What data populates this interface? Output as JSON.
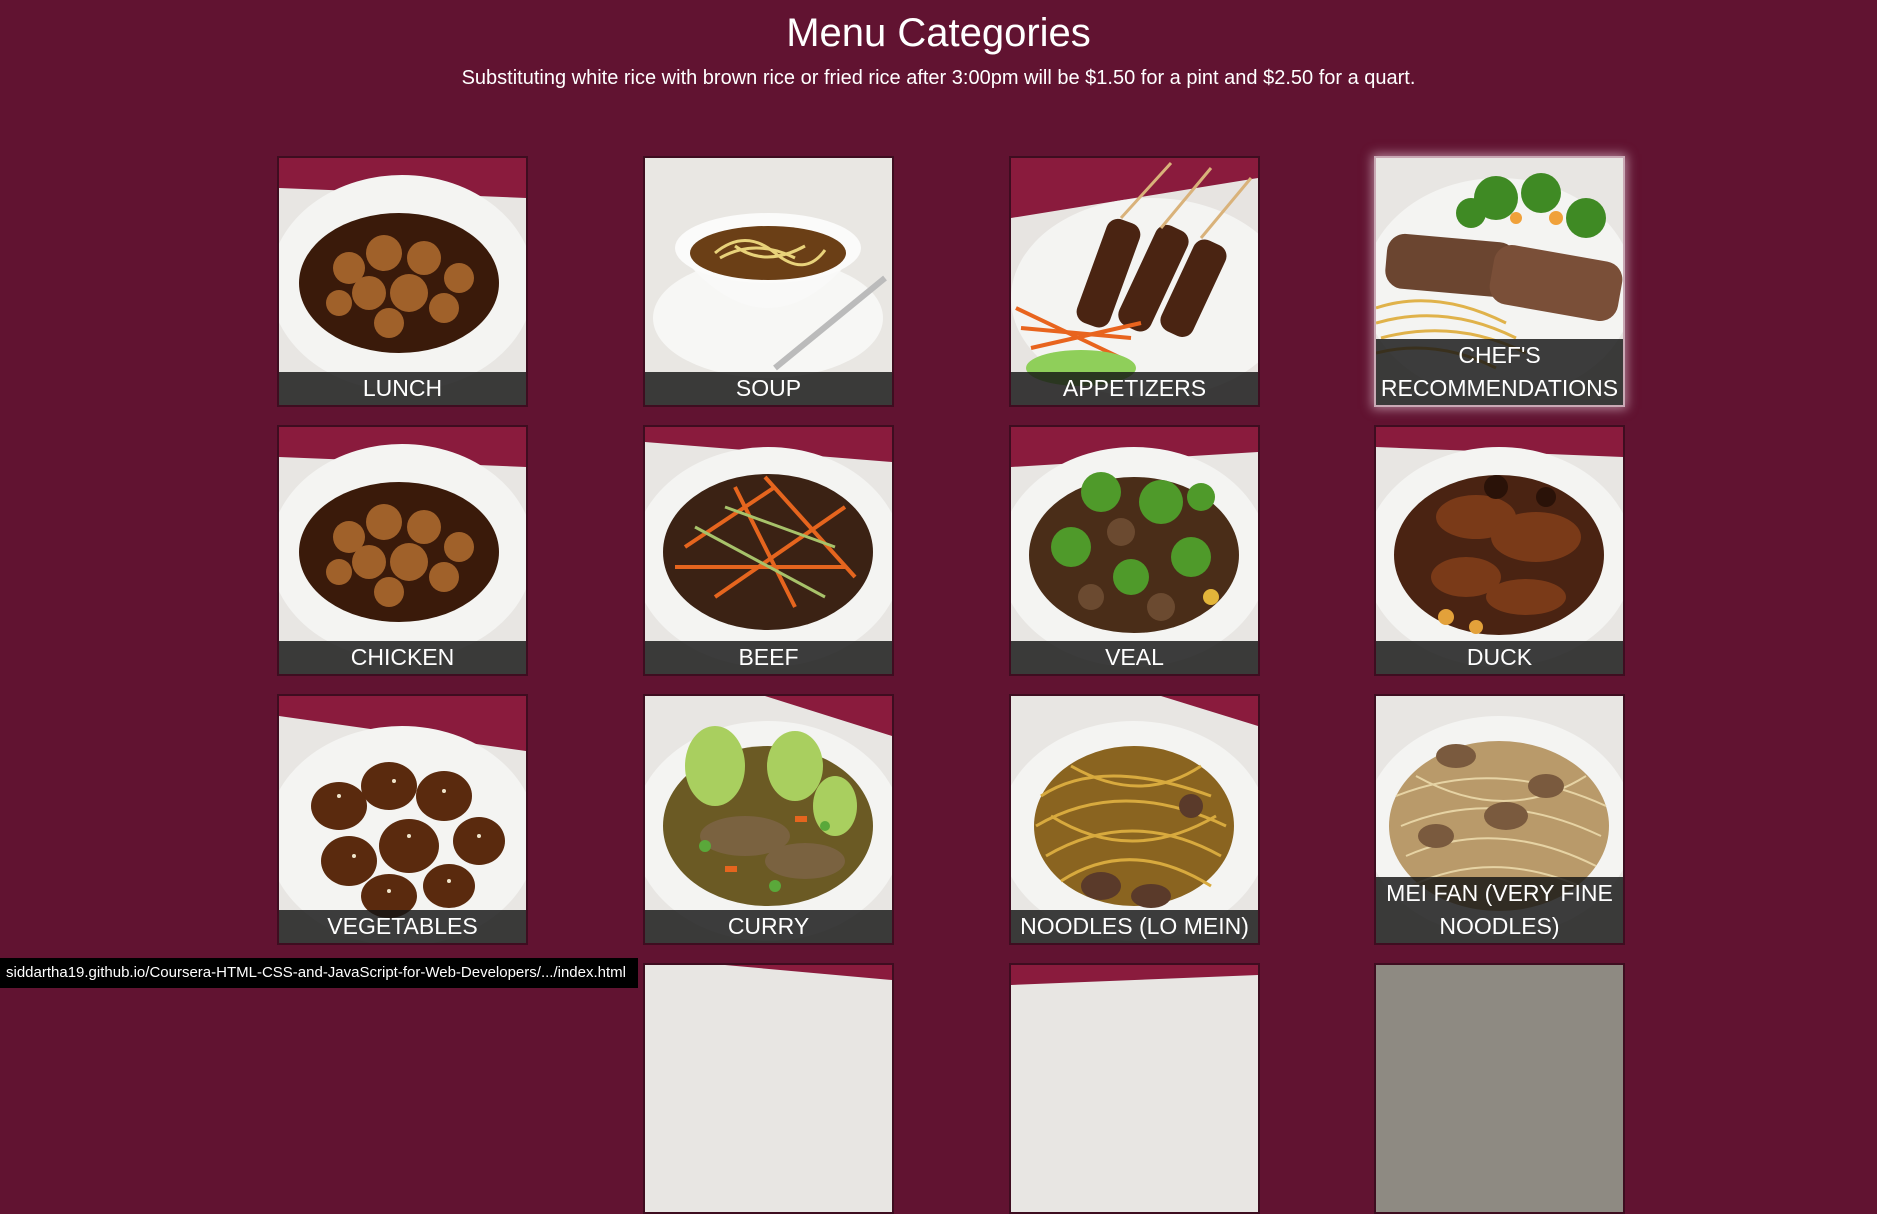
{
  "header": {
    "title": "Menu Categories",
    "subtitle": "Substituting white rice with brown rice or fried rice after 3:00pm will be $1.50 for a pint and $2.50 for a quart."
  },
  "categories": [
    {
      "label": "LUNCH",
      "dish": "sauced-chicken"
    },
    {
      "label": "SOUP",
      "dish": "soup"
    },
    {
      "label": "APPETIZERS",
      "dish": "skewers"
    },
    {
      "label": "CHEF'S RECOMMENDATIONS",
      "dish": "steak-noodles"
    },
    {
      "label": "CHICKEN",
      "dish": "sauced-chicken"
    },
    {
      "label": "BEEF",
      "dish": "shredded-beef"
    },
    {
      "label": "VEAL",
      "dish": "broccoli-veal"
    },
    {
      "label": "DUCK",
      "dish": "duck"
    },
    {
      "label": "VEGETABLES",
      "dish": "sesame"
    },
    {
      "label": "CURRY",
      "dish": "curry"
    },
    {
      "label": "NOODLES (LO MEIN)",
      "dish": "lo-mein"
    },
    {
      "label": "MEI FAN (VERY FINE NOODLES)",
      "dish": "mei-fan"
    }
  ],
  "status_bar": {
    "url": "siddartha19.github.io/Coursera-HTML-CSS-and-JavaScript-for-Web-Developers/.../index.html"
  },
  "colors": {
    "background": "#611331",
    "caption": "#141414",
    "tablecloth": "#8a1b3d"
  }
}
